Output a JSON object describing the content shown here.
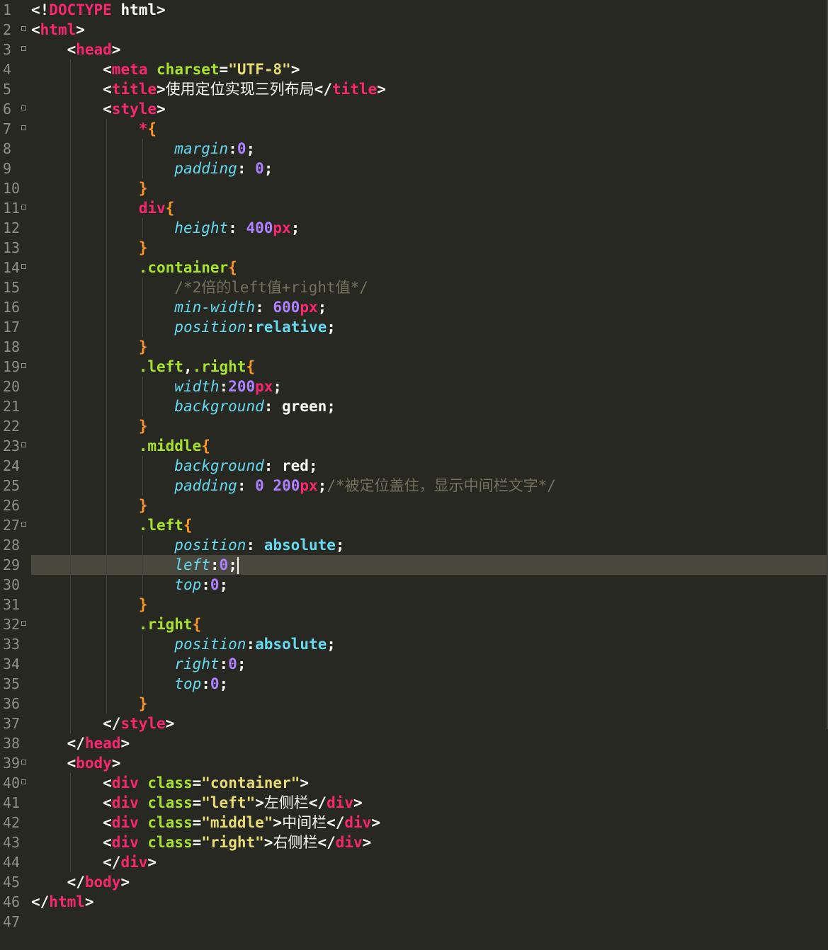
{
  "editor": {
    "theme": "monokai",
    "active_line": 29,
    "colors": {
      "background": "#272822",
      "gutter_text": "#8f908a",
      "active_line": "#49483e",
      "tag": "#f92672",
      "attribute": "#a6e22e",
      "string": "#e6db74",
      "selector": "#a6e22e",
      "property": "#66d9ef",
      "number": "#ae81ff",
      "brace": "#fd971f",
      "comment": "#75715e",
      "text": "#f8f8f2"
    },
    "lines": [
      {
        "n": "1",
        "fold": false,
        "tokens": [
          {
            "t": "plain",
            "v": "<!"
          },
          {
            "t": "tag",
            "v": "DOCTYPE"
          },
          {
            "t": "plain",
            "v": " html>"
          }
        ]
      },
      {
        "n": "2",
        "fold": true,
        "tokens": [
          {
            "t": "plain",
            "v": "<"
          },
          {
            "t": "tag",
            "v": "html"
          },
          {
            "t": "plain",
            "v": ">"
          }
        ]
      },
      {
        "n": "3",
        "fold": true,
        "tokens": [
          {
            "t": "plain",
            "v": "    <"
          },
          {
            "t": "tag",
            "v": "head"
          },
          {
            "t": "plain",
            "v": ">"
          }
        ]
      },
      {
        "n": "4",
        "fold": false,
        "tokens": [
          {
            "t": "plain",
            "v": "        <"
          },
          {
            "t": "tag",
            "v": "meta"
          },
          {
            "t": "plain",
            "v": " "
          },
          {
            "t": "attr",
            "v": "charset"
          },
          {
            "t": "plain",
            "v": "="
          },
          {
            "t": "str",
            "v": "\"UTF-8\""
          },
          {
            "t": "plain",
            "v": ">"
          }
        ]
      },
      {
        "n": "5",
        "fold": false,
        "tokens": [
          {
            "t": "plain",
            "v": "        <"
          },
          {
            "t": "tag",
            "v": "title"
          },
          {
            "t": "plain",
            "v": ">"
          },
          {
            "t": "cjk",
            "v": "使用定位实现三列布局"
          },
          {
            "t": "plain",
            "v": "</"
          },
          {
            "t": "tag",
            "v": "title"
          },
          {
            "t": "plain",
            "v": ">"
          }
        ]
      },
      {
        "n": "6",
        "fold": true,
        "tokens": [
          {
            "t": "plain",
            "v": "        <"
          },
          {
            "t": "tag",
            "v": "style"
          },
          {
            "t": "plain",
            "v": ">"
          }
        ]
      },
      {
        "n": "7",
        "fold": true,
        "tokens": [
          {
            "t": "plain",
            "v": "            "
          },
          {
            "t": "tag",
            "v": "*"
          },
          {
            "t": "brace",
            "v": "{"
          }
        ]
      },
      {
        "n": "8",
        "fold": false,
        "tokens": [
          {
            "t": "plain",
            "v": "                "
          },
          {
            "t": "prop",
            "v": "margin"
          },
          {
            "t": "plain",
            "v": ":"
          },
          {
            "t": "num",
            "v": "0"
          },
          {
            "t": "plain",
            "v": ";"
          }
        ]
      },
      {
        "n": "9",
        "fold": false,
        "tokens": [
          {
            "t": "plain",
            "v": "                "
          },
          {
            "t": "prop",
            "v": "padding"
          },
          {
            "t": "plain",
            "v": ": "
          },
          {
            "t": "num",
            "v": "0"
          },
          {
            "t": "plain",
            "v": ";"
          }
        ]
      },
      {
        "n": "10",
        "fold": false,
        "tokens": [
          {
            "t": "plain",
            "v": "            "
          },
          {
            "t": "brace",
            "v": "}"
          }
        ]
      },
      {
        "n": "11",
        "fold": true,
        "tokens": [
          {
            "t": "plain",
            "v": "            "
          },
          {
            "t": "tag",
            "v": "div"
          },
          {
            "t": "brace",
            "v": "{"
          }
        ]
      },
      {
        "n": "12",
        "fold": false,
        "tokens": [
          {
            "t": "plain",
            "v": "                "
          },
          {
            "t": "prop",
            "v": "height"
          },
          {
            "t": "plain",
            "v": ": "
          },
          {
            "t": "num",
            "v": "400"
          },
          {
            "t": "unit",
            "v": "px"
          },
          {
            "t": "plain",
            "v": ";"
          }
        ]
      },
      {
        "n": "13",
        "fold": false,
        "tokens": [
          {
            "t": "plain",
            "v": "            "
          },
          {
            "t": "brace",
            "v": "}"
          }
        ]
      },
      {
        "n": "14",
        "fold": true,
        "tokens": [
          {
            "t": "plain",
            "v": "            "
          },
          {
            "t": "sel",
            "v": ".container"
          },
          {
            "t": "brace",
            "v": "{"
          }
        ]
      },
      {
        "n": "15",
        "fold": false,
        "tokens": [
          {
            "t": "plain",
            "v": "                "
          },
          {
            "t": "com",
            "v": "/*2倍的left值+right值*/"
          }
        ]
      },
      {
        "n": "16",
        "fold": false,
        "tokens": [
          {
            "t": "plain",
            "v": "                "
          },
          {
            "t": "prop",
            "v": "min-width"
          },
          {
            "t": "plain",
            "v": ": "
          },
          {
            "t": "num",
            "v": "600"
          },
          {
            "t": "unit",
            "v": "px"
          },
          {
            "t": "plain",
            "v": ";"
          }
        ]
      },
      {
        "n": "17",
        "fold": false,
        "tokens": [
          {
            "t": "plain",
            "v": "                "
          },
          {
            "t": "prop",
            "v": "position"
          },
          {
            "t": "plain",
            "v": ":"
          },
          {
            "t": "kw",
            "v": "relative"
          },
          {
            "t": "plain",
            "v": ";"
          }
        ]
      },
      {
        "n": "18",
        "fold": false,
        "tokens": [
          {
            "t": "plain",
            "v": "            "
          },
          {
            "t": "brace",
            "v": "}"
          }
        ]
      },
      {
        "n": "19",
        "fold": true,
        "tokens": [
          {
            "t": "plain",
            "v": "            "
          },
          {
            "t": "sel",
            "v": ".left"
          },
          {
            "t": "plain",
            "v": ","
          },
          {
            "t": "sel",
            "v": ".right"
          },
          {
            "t": "brace",
            "v": "{"
          }
        ]
      },
      {
        "n": "20",
        "fold": false,
        "tokens": [
          {
            "t": "plain",
            "v": "                "
          },
          {
            "t": "prop",
            "v": "width"
          },
          {
            "t": "plain",
            "v": ":"
          },
          {
            "t": "num",
            "v": "200"
          },
          {
            "t": "unit",
            "v": "px"
          },
          {
            "t": "plain",
            "v": ";"
          }
        ]
      },
      {
        "n": "21",
        "fold": false,
        "tokens": [
          {
            "t": "plain",
            "v": "                "
          },
          {
            "t": "prop",
            "v": "background"
          },
          {
            "t": "plain",
            "v": ": green;"
          }
        ]
      },
      {
        "n": "22",
        "fold": false,
        "tokens": [
          {
            "t": "plain",
            "v": "            "
          },
          {
            "t": "brace",
            "v": "}"
          }
        ]
      },
      {
        "n": "23",
        "fold": true,
        "tokens": [
          {
            "t": "plain",
            "v": "            "
          },
          {
            "t": "sel",
            "v": ".middle"
          },
          {
            "t": "brace",
            "v": "{"
          }
        ]
      },
      {
        "n": "24",
        "fold": false,
        "tokens": [
          {
            "t": "plain",
            "v": "                "
          },
          {
            "t": "prop",
            "v": "background"
          },
          {
            "t": "plain",
            "v": ": red;"
          }
        ]
      },
      {
        "n": "25",
        "fold": false,
        "tokens": [
          {
            "t": "plain",
            "v": "                "
          },
          {
            "t": "prop",
            "v": "padding"
          },
          {
            "t": "plain",
            "v": ": "
          },
          {
            "t": "num",
            "v": "0"
          },
          {
            "t": "plain",
            "v": " "
          },
          {
            "t": "num",
            "v": "200"
          },
          {
            "t": "unit",
            "v": "px"
          },
          {
            "t": "plain",
            "v": ";"
          },
          {
            "t": "com",
            "v": "/*被定位盖住，显示中间栏文字*/"
          }
        ]
      },
      {
        "n": "26",
        "fold": false,
        "tokens": [
          {
            "t": "plain",
            "v": "            "
          },
          {
            "t": "brace",
            "v": "}"
          }
        ]
      },
      {
        "n": "27",
        "fold": true,
        "tokens": [
          {
            "t": "plain",
            "v": "            "
          },
          {
            "t": "sel",
            "v": ".left"
          },
          {
            "t": "brace",
            "v": "{"
          }
        ]
      },
      {
        "n": "28",
        "fold": false,
        "tokens": [
          {
            "t": "plain",
            "v": "                "
          },
          {
            "t": "prop",
            "v": "position"
          },
          {
            "t": "plain",
            "v": ": "
          },
          {
            "t": "kw",
            "v": "absolute"
          },
          {
            "t": "plain",
            "v": ";"
          }
        ]
      },
      {
        "n": "29",
        "fold": false,
        "tokens": [
          {
            "t": "plain",
            "v": "                "
          },
          {
            "t": "prop",
            "v": "left"
          },
          {
            "t": "plain",
            "v": ":"
          },
          {
            "t": "num",
            "v": "0"
          },
          {
            "t": "plain",
            "v": ";"
          },
          {
            "t": "cursor",
            "v": ""
          }
        ]
      },
      {
        "n": "30",
        "fold": false,
        "tokens": [
          {
            "t": "plain",
            "v": "                "
          },
          {
            "t": "prop",
            "v": "top"
          },
          {
            "t": "plain",
            "v": ":"
          },
          {
            "t": "num",
            "v": "0"
          },
          {
            "t": "plain",
            "v": ";"
          }
        ]
      },
      {
        "n": "31",
        "fold": false,
        "tokens": [
          {
            "t": "plain",
            "v": "            "
          },
          {
            "t": "brace",
            "v": "}"
          }
        ]
      },
      {
        "n": "32",
        "fold": true,
        "tokens": [
          {
            "t": "plain",
            "v": "            "
          },
          {
            "t": "sel",
            "v": ".right"
          },
          {
            "t": "brace",
            "v": "{"
          }
        ]
      },
      {
        "n": "33",
        "fold": false,
        "tokens": [
          {
            "t": "plain",
            "v": "                "
          },
          {
            "t": "prop",
            "v": "position"
          },
          {
            "t": "plain",
            "v": ":"
          },
          {
            "t": "kw",
            "v": "absolute"
          },
          {
            "t": "plain",
            "v": ";"
          }
        ]
      },
      {
        "n": "34",
        "fold": false,
        "tokens": [
          {
            "t": "plain",
            "v": "                "
          },
          {
            "t": "prop",
            "v": "right"
          },
          {
            "t": "plain",
            "v": ":"
          },
          {
            "t": "num",
            "v": "0"
          },
          {
            "t": "plain",
            "v": ";"
          }
        ]
      },
      {
        "n": "35",
        "fold": false,
        "tokens": [
          {
            "t": "plain",
            "v": "                "
          },
          {
            "t": "prop",
            "v": "top"
          },
          {
            "t": "plain",
            "v": ":"
          },
          {
            "t": "num",
            "v": "0"
          },
          {
            "t": "plain",
            "v": ";"
          }
        ]
      },
      {
        "n": "36",
        "fold": false,
        "tokens": [
          {
            "t": "plain",
            "v": "            "
          },
          {
            "t": "brace",
            "v": "}"
          }
        ]
      },
      {
        "n": "37",
        "fold": false,
        "tokens": [
          {
            "t": "plain",
            "v": "        </"
          },
          {
            "t": "tag",
            "v": "style"
          },
          {
            "t": "plain",
            "v": ">"
          }
        ]
      },
      {
        "n": "38",
        "fold": false,
        "tokens": [
          {
            "t": "plain",
            "v": "    </"
          },
          {
            "t": "tag",
            "v": "head"
          },
          {
            "t": "plain",
            "v": ">"
          }
        ]
      },
      {
        "n": "39",
        "fold": true,
        "tokens": [
          {
            "t": "plain",
            "v": "    <"
          },
          {
            "t": "tag",
            "v": "body"
          },
          {
            "t": "plain",
            "v": ">"
          }
        ]
      },
      {
        "n": "40",
        "fold": true,
        "tokens": [
          {
            "t": "plain",
            "v": "        <"
          },
          {
            "t": "tag",
            "v": "div"
          },
          {
            "t": "plain",
            "v": " "
          },
          {
            "t": "attr",
            "v": "class"
          },
          {
            "t": "plain",
            "v": "="
          },
          {
            "t": "str",
            "v": "\"container\""
          },
          {
            "t": "plain",
            "v": ">"
          }
        ]
      },
      {
        "n": "41",
        "fold": false,
        "tokens": [
          {
            "t": "plain",
            "v": "        <"
          },
          {
            "t": "tag",
            "v": "div"
          },
          {
            "t": "plain",
            "v": " "
          },
          {
            "t": "attr",
            "v": "class"
          },
          {
            "t": "plain",
            "v": "="
          },
          {
            "t": "str",
            "v": "\"left\""
          },
          {
            "t": "plain",
            "v": ">"
          },
          {
            "t": "cjk",
            "v": "左侧栏"
          },
          {
            "t": "plain",
            "v": "</"
          },
          {
            "t": "tag",
            "v": "div"
          },
          {
            "t": "plain",
            "v": ">"
          }
        ]
      },
      {
        "n": "42",
        "fold": false,
        "tokens": [
          {
            "t": "plain",
            "v": "        <"
          },
          {
            "t": "tag",
            "v": "div"
          },
          {
            "t": "plain",
            "v": " "
          },
          {
            "t": "attr",
            "v": "class"
          },
          {
            "t": "plain",
            "v": "="
          },
          {
            "t": "str",
            "v": "\"middle\""
          },
          {
            "t": "plain",
            "v": ">"
          },
          {
            "t": "cjk",
            "v": "中间栏"
          },
          {
            "t": "plain",
            "v": "</"
          },
          {
            "t": "tag",
            "v": "div"
          },
          {
            "t": "plain",
            "v": ">"
          }
        ]
      },
      {
        "n": "43",
        "fold": false,
        "tokens": [
          {
            "t": "plain",
            "v": "        <"
          },
          {
            "t": "tag",
            "v": "div"
          },
          {
            "t": "plain",
            "v": " "
          },
          {
            "t": "attr",
            "v": "class"
          },
          {
            "t": "plain",
            "v": "="
          },
          {
            "t": "str",
            "v": "\"right\""
          },
          {
            "t": "plain",
            "v": ">"
          },
          {
            "t": "cjk",
            "v": "右侧栏"
          },
          {
            "t": "plain",
            "v": "</"
          },
          {
            "t": "tag",
            "v": "div"
          },
          {
            "t": "plain",
            "v": ">"
          }
        ]
      },
      {
        "n": "44",
        "fold": false,
        "tokens": [
          {
            "t": "plain",
            "v": "        </"
          },
          {
            "t": "tag",
            "v": "div"
          },
          {
            "t": "plain",
            "v": ">"
          }
        ]
      },
      {
        "n": "45",
        "fold": false,
        "tokens": [
          {
            "t": "plain",
            "v": "    </"
          },
          {
            "t": "tag",
            "v": "body"
          },
          {
            "t": "plain",
            "v": ">"
          }
        ]
      },
      {
        "n": "46",
        "fold": false,
        "tokens": [
          {
            "t": "plain",
            "v": "</"
          },
          {
            "t": "tag",
            "v": "html"
          },
          {
            "t": "plain",
            "v": ">"
          }
        ]
      },
      {
        "n": "47",
        "fold": false,
        "tokens": []
      }
    ]
  }
}
